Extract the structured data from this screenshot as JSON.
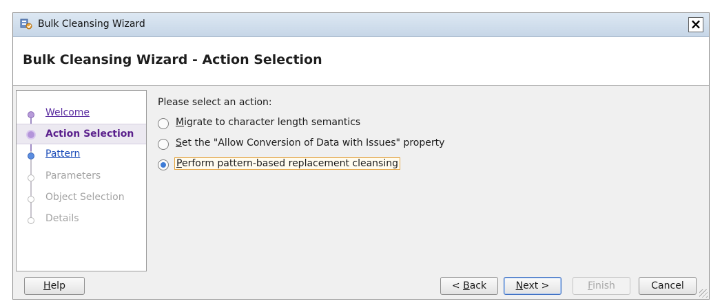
{
  "window": {
    "title": "Bulk Cleansing Wizard",
    "close_glyph": "×"
  },
  "header": {
    "title": "Bulk Cleansing Wizard - Action Selection"
  },
  "steps": [
    {
      "label": "Welcome",
      "state": "visited"
    },
    {
      "label": "Action Selection",
      "state": "current"
    },
    {
      "label": "Pattern",
      "state": "next"
    },
    {
      "label": "Parameters",
      "state": "disabled"
    },
    {
      "label": "Object Selection",
      "state": "disabled"
    },
    {
      "label": "Details",
      "state": "disabled"
    }
  ],
  "content": {
    "prompt": "Please select an action:",
    "options": [
      {
        "mnemonic": "M",
        "rest": "igrate to character length semantics",
        "checked": false
      },
      {
        "mnemonic": "S",
        "rest": "et the \"Allow Conversion of Data with Issues\" property",
        "checked": false
      },
      {
        "mnemonic": "P",
        "rest": "erform pattern-based replacement cleansing",
        "checked": true
      }
    ]
  },
  "buttons": {
    "help": {
      "mnemonic": "H",
      "rest": "elp"
    },
    "back": {
      "prefix": "< ",
      "mnemonic": "B",
      "rest": "ack"
    },
    "next": {
      "mnemonic": "N",
      "rest": "ext >"
    },
    "finish": {
      "mnemonic": "F",
      "rest": "inish"
    },
    "cancel": {
      "label": "Cancel"
    }
  },
  "colors": {
    "current_step": "#5a1f8c",
    "visited_link": "#5a2ca0",
    "link": "#1a4bb8",
    "focus_border": "#e6a33a",
    "default_button_border": "#3b6ec2"
  }
}
